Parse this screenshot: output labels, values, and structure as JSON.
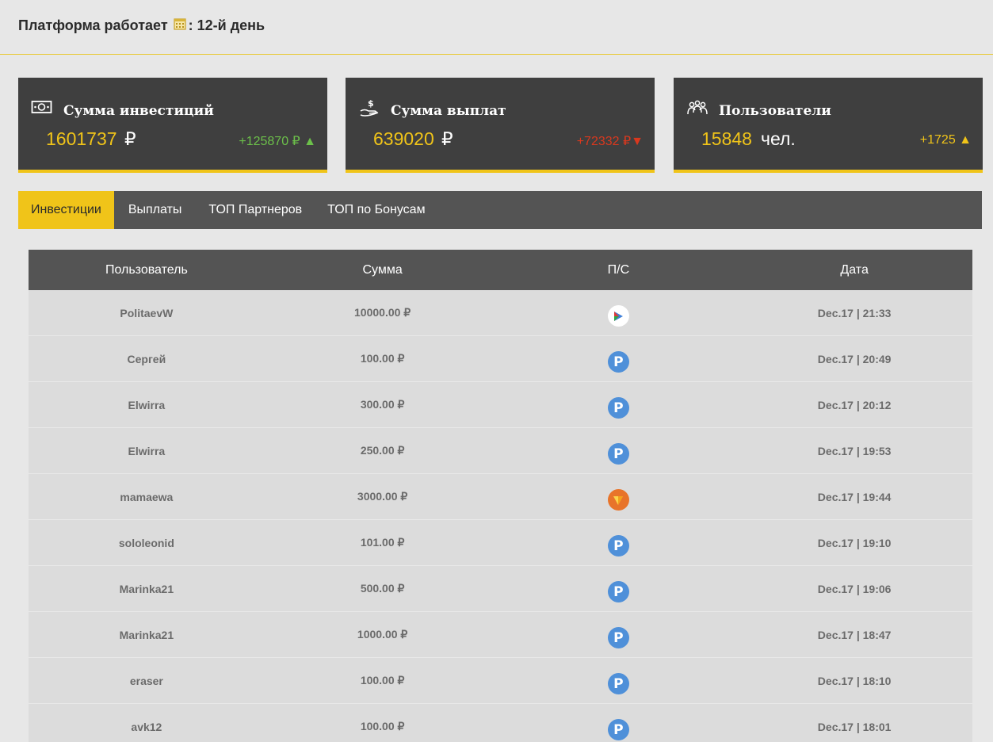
{
  "header": {
    "prefix": "Платформа работает",
    "suffix": ": 12-й день"
  },
  "cards": [
    {
      "title": "Сумма инвестиций",
      "icon": "money-icon",
      "value": "1601737",
      "unit": "₽",
      "delta": "+125870 ₽ ▲",
      "delta_color": "#6cc04a"
    },
    {
      "title": "Сумма выплат",
      "icon": "payout-hand-icon",
      "value": "639020",
      "unit": "₽",
      "delta": "+72332 ₽▼",
      "delta_color": "#d9381e"
    },
    {
      "title": "Пользователи",
      "icon": "users-group-icon",
      "value": "15848",
      "unit": "чел.",
      "delta": "+1725 ▲",
      "delta_color": "#f0c419"
    }
  ],
  "tabs": [
    {
      "label": "Инвестиции",
      "active": true
    },
    {
      "label": "Выплаты",
      "active": false
    },
    {
      "label": "ТОП Партнеров",
      "active": false
    },
    {
      "label": "ТОП по Бонусам",
      "active": false
    }
  ],
  "table": {
    "columns": [
      "Пользователь",
      "Сумма",
      "П/С",
      "Дата"
    ],
    "rows": [
      {
        "user": "PolitaevW",
        "amount": "10000.00 ₽",
        "ps": "play-icon",
        "date": "Dec.17 | 21:33"
      },
      {
        "user": "Сергей",
        "amount": "100.00 ₽",
        "ps": "payeer-icon",
        "date": "Dec.17 | 20:49"
      },
      {
        "user": "Elwirra",
        "amount": "300.00 ₽",
        "ps": "payeer-icon",
        "date": "Dec.17 | 20:12"
      },
      {
        "user": "Elwirra",
        "amount": "250.00 ₽",
        "ps": "payeer-icon",
        "date": "Dec.17 | 19:53"
      },
      {
        "user": "mamaewa",
        "amount": "3000.00 ₽",
        "ps": "orange-arrow-icon",
        "date": "Dec.17 | 19:44"
      },
      {
        "user": "sololeonid",
        "amount": "101.00 ₽",
        "ps": "payeer-icon",
        "date": "Dec.17 | 19:10"
      },
      {
        "user": "Marinka21",
        "amount": "500.00 ₽",
        "ps": "payeer-icon",
        "date": "Dec.17 | 19:06"
      },
      {
        "user": "Marinka21",
        "amount": "1000.00 ₽",
        "ps": "payeer-icon",
        "date": "Dec.17 | 18:47"
      },
      {
        "user": "eraser",
        "amount": "100.00 ₽",
        "ps": "payeer-icon",
        "date": "Dec.17 | 18:10"
      },
      {
        "user": "avk12",
        "amount": "100.00 ₽",
        "ps": "payeer-icon",
        "date": "Dec.17 | 18:01"
      }
    ]
  },
  "colors": {
    "accent": "#f0c419",
    "panel": "#3f3f3f",
    "bar": "#545454",
    "payeer": "#4f90d9"
  }
}
